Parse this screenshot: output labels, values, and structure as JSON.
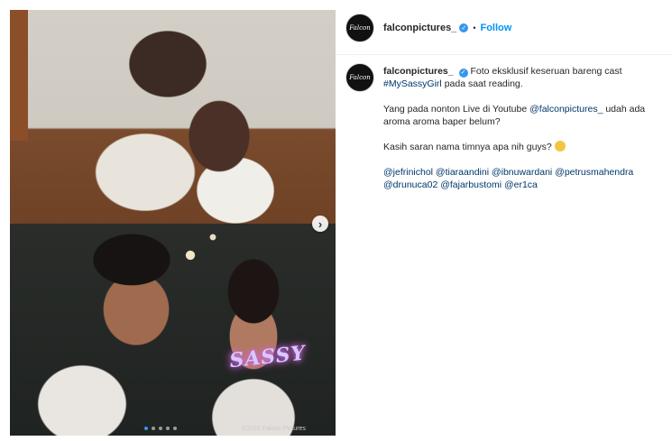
{
  "post": {
    "username": "falconpictures_",
    "avatar_text": "Falcon",
    "separator": "•",
    "follow_label": "Follow",
    "caption_line1": "Foto eksklusif keseruan bareng cast",
    "caption_hashtag": "#MySassyGirl",
    "caption_line1_end": "pada saat reading.",
    "para2_start": "Yang pada nonton Live di Youtube",
    "para2_mention": "@falconpictures_",
    "para2_end": "udah ada aroma aroma baper belum?",
    "para3": "Kasih saran nama timnya apa nih guys?",
    "mentions_line1": "@jefrinichol @tiaraandini @ibnuwardani @petrusmahendra",
    "mentions_line2": "@drunuca02 @fajarbustomi @er1ca"
  },
  "media": {
    "logo_overlay": "SASSY",
    "watermark": "©2021 Falcon Pictures",
    "next_glyph": "›",
    "carousel_index": 1,
    "carousel_total": 5
  },
  "colors": {
    "link": "#00376b",
    "follow": "#0095f6",
    "active_dot": "#3797f0"
  }
}
